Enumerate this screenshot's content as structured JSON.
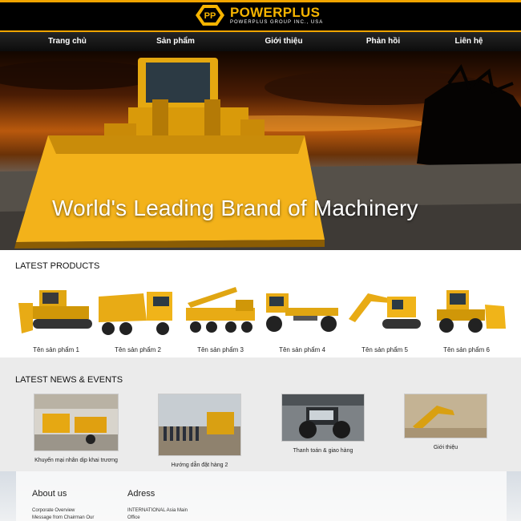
{
  "brand": {
    "name": "POWERPLUS",
    "tagline": "POWERPLUS GROUP INC., USA"
  },
  "nav": {
    "items": [
      "Trang chủ",
      "Sản phẩm",
      "Giới thiệu",
      "Phản hồi",
      "Liên hệ"
    ]
  },
  "hero": {
    "title": "World's Leading Brand of Machinery"
  },
  "latest_products": {
    "title": "LATEST PRODUCTS",
    "items": [
      "Tên sản phẩm 1",
      "Tên sản phẩm 2",
      "Tên sản phẩm 3",
      "Tên sản phẩm 4",
      "Tên sản phẩm 5",
      "Tên sản phẩm 6"
    ]
  },
  "latest_news": {
    "title": "LATEST NEWS & EVENTS",
    "items": [
      "Khuyến mại nhân dịp khai trương",
      "Hướng dẫn đặt hàng 2",
      "Thanh toán & giao hàng",
      "Giới thiệu"
    ]
  },
  "footer": {
    "about_title": "About us",
    "about_links": [
      "Corporate Overview",
      "Message from Chairman Our"
    ],
    "address_title": "Adress",
    "address_lines": [
      "INTERNATIONAL Asia Main",
      "Office"
    ]
  },
  "colors": {
    "accent": "#f0a400",
    "nav_bg": "#1a1a1a"
  }
}
